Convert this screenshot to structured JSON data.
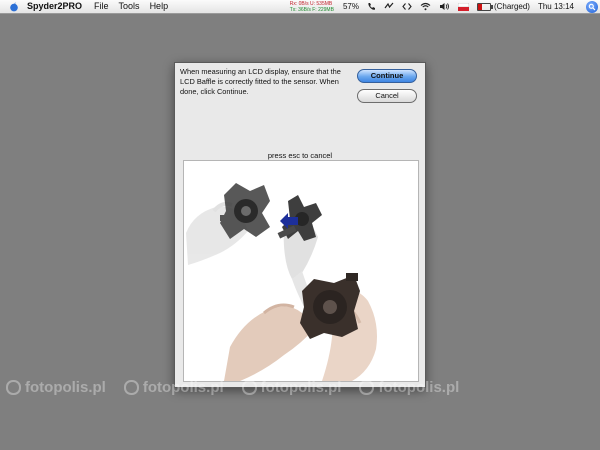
{
  "menubar": {
    "app_name": "Spyder2PRO",
    "items": [
      "File",
      "Tools",
      "Help"
    ],
    "net_rx_label": "Rx:",
    "net_rx_rate": "0B/s",
    "net_rx_u": "U: 535MB",
    "net_tx_label": "Tx:",
    "net_tx_rate": "36B/s",
    "net_tx_f": "F: 229MB",
    "cpu_percent": "57%",
    "battery_status": "(Charged)",
    "clock": "Thu 13:14"
  },
  "dialog": {
    "instruction": "When measuring an LCD display, ensure that the LCD Baffle is correctly fitted to the sensor. When done, click Continue.",
    "continue_label": "Continue",
    "cancel_label": "Cancel",
    "esc_label": "press esc to cancel"
  },
  "watermark": {
    "text": "fotopolis.pl"
  },
  "colors": {
    "desktop": "#7f7f7f",
    "dialog_bg": "#e9e9e9",
    "default_button": "#4f92e6",
    "arrow": "#1d2f9a"
  }
}
